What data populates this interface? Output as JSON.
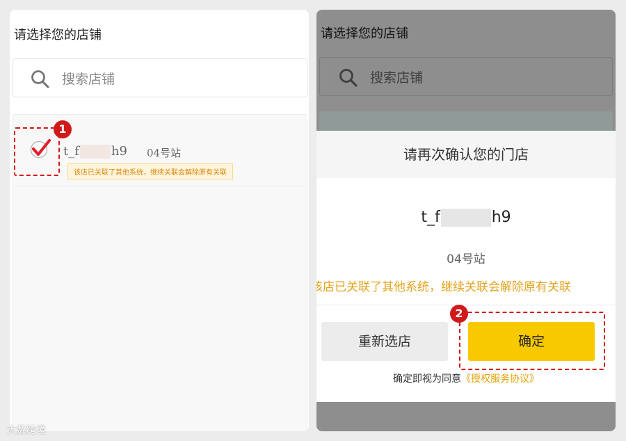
{
  "left": {
    "title": "请选择您的店铺",
    "search_placeholder": "搜索店铺",
    "store": {
      "name_prefix": "t_f",
      "name_suffix": "h9",
      "station": "04号站",
      "warning": "该店已关联了其他系统，继续关联会解除原有关联",
      "checked": true
    },
    "marker": "1"
  },
  "right": {
    "title": "请选择您的店铺",
    "search_placeholder": "搜索店铺",
    "dialog": {
      "header": "请再次确认您的门店",
      "name_prefix": "t_f",
      "name_suffix": "h9",
      "station": "04号站",
      "warning": "该店已关联了其他系统，继续关联会解除原有关联",
      "reselect_label": "重新选店",
      "confirm_label": "确定",
      "agree_text": "确定即视为同意",
      "agree_link": "《授权服务协议》"
    },
    "marker": "2"
  },
  "watermark": "大数跨境",
  "colors": {
    "accent": "#f9c900",
    "check_red": "#e0202a",
    "annotation_red": "#d01919",
    "warning_orange": "#e3a21a"
  },
  "icons": {
    "search": "search-icon",
    "check": "checkmark-icon"
  }
}
